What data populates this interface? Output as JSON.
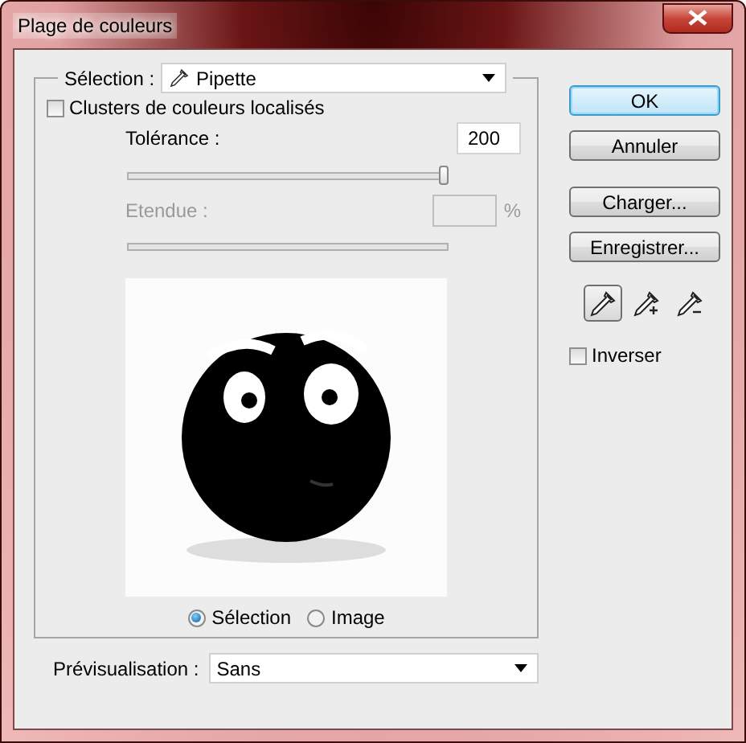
{
  "window": {
    "title": "Plage de couleurs"
  },
  "selection": {
    "label": "Sélection :",
    "value": "Pipette"
  },
  "localized_clusters": {
    "label": "Clusters de couleurs localisés",
    "checked": false
  },
  "tolerance": {
    "label": "Tolérance :",
    "value": "200",
    "level": 1
  },
  "range": {
    "label": "Etendue :",
    "unit": "%",
    "disabled": true
  },
  "preview_mode": [
    {
      "label": "Sélection",
      "selected": true
    },
    {
      "label": "Image",
      "selected": false
    }
  ],
  "buttons": [
    {
      "label": "OK",
      "default": true
    },
    {
      "label": "Annuler",
      "default": false
    },
    {
      "label": "Charger...",
      "default": false
    },
    {
      "label": "Enregistrer...",
      "default": false
    }
  ],
  "tools": [
    {
      "kind": "sample",
      "selected": true
    },
    {
      "kind": "add",
      "selected": false
    },
    {
      "kind": "subtract",
      "selected": false
    }
  ],
  "invert": {
    "label": "Inverser",
    "checked": false
  },
  "preview": {
    "label": "Prévisualisation :",
    "value": "Sans"
  }
}
